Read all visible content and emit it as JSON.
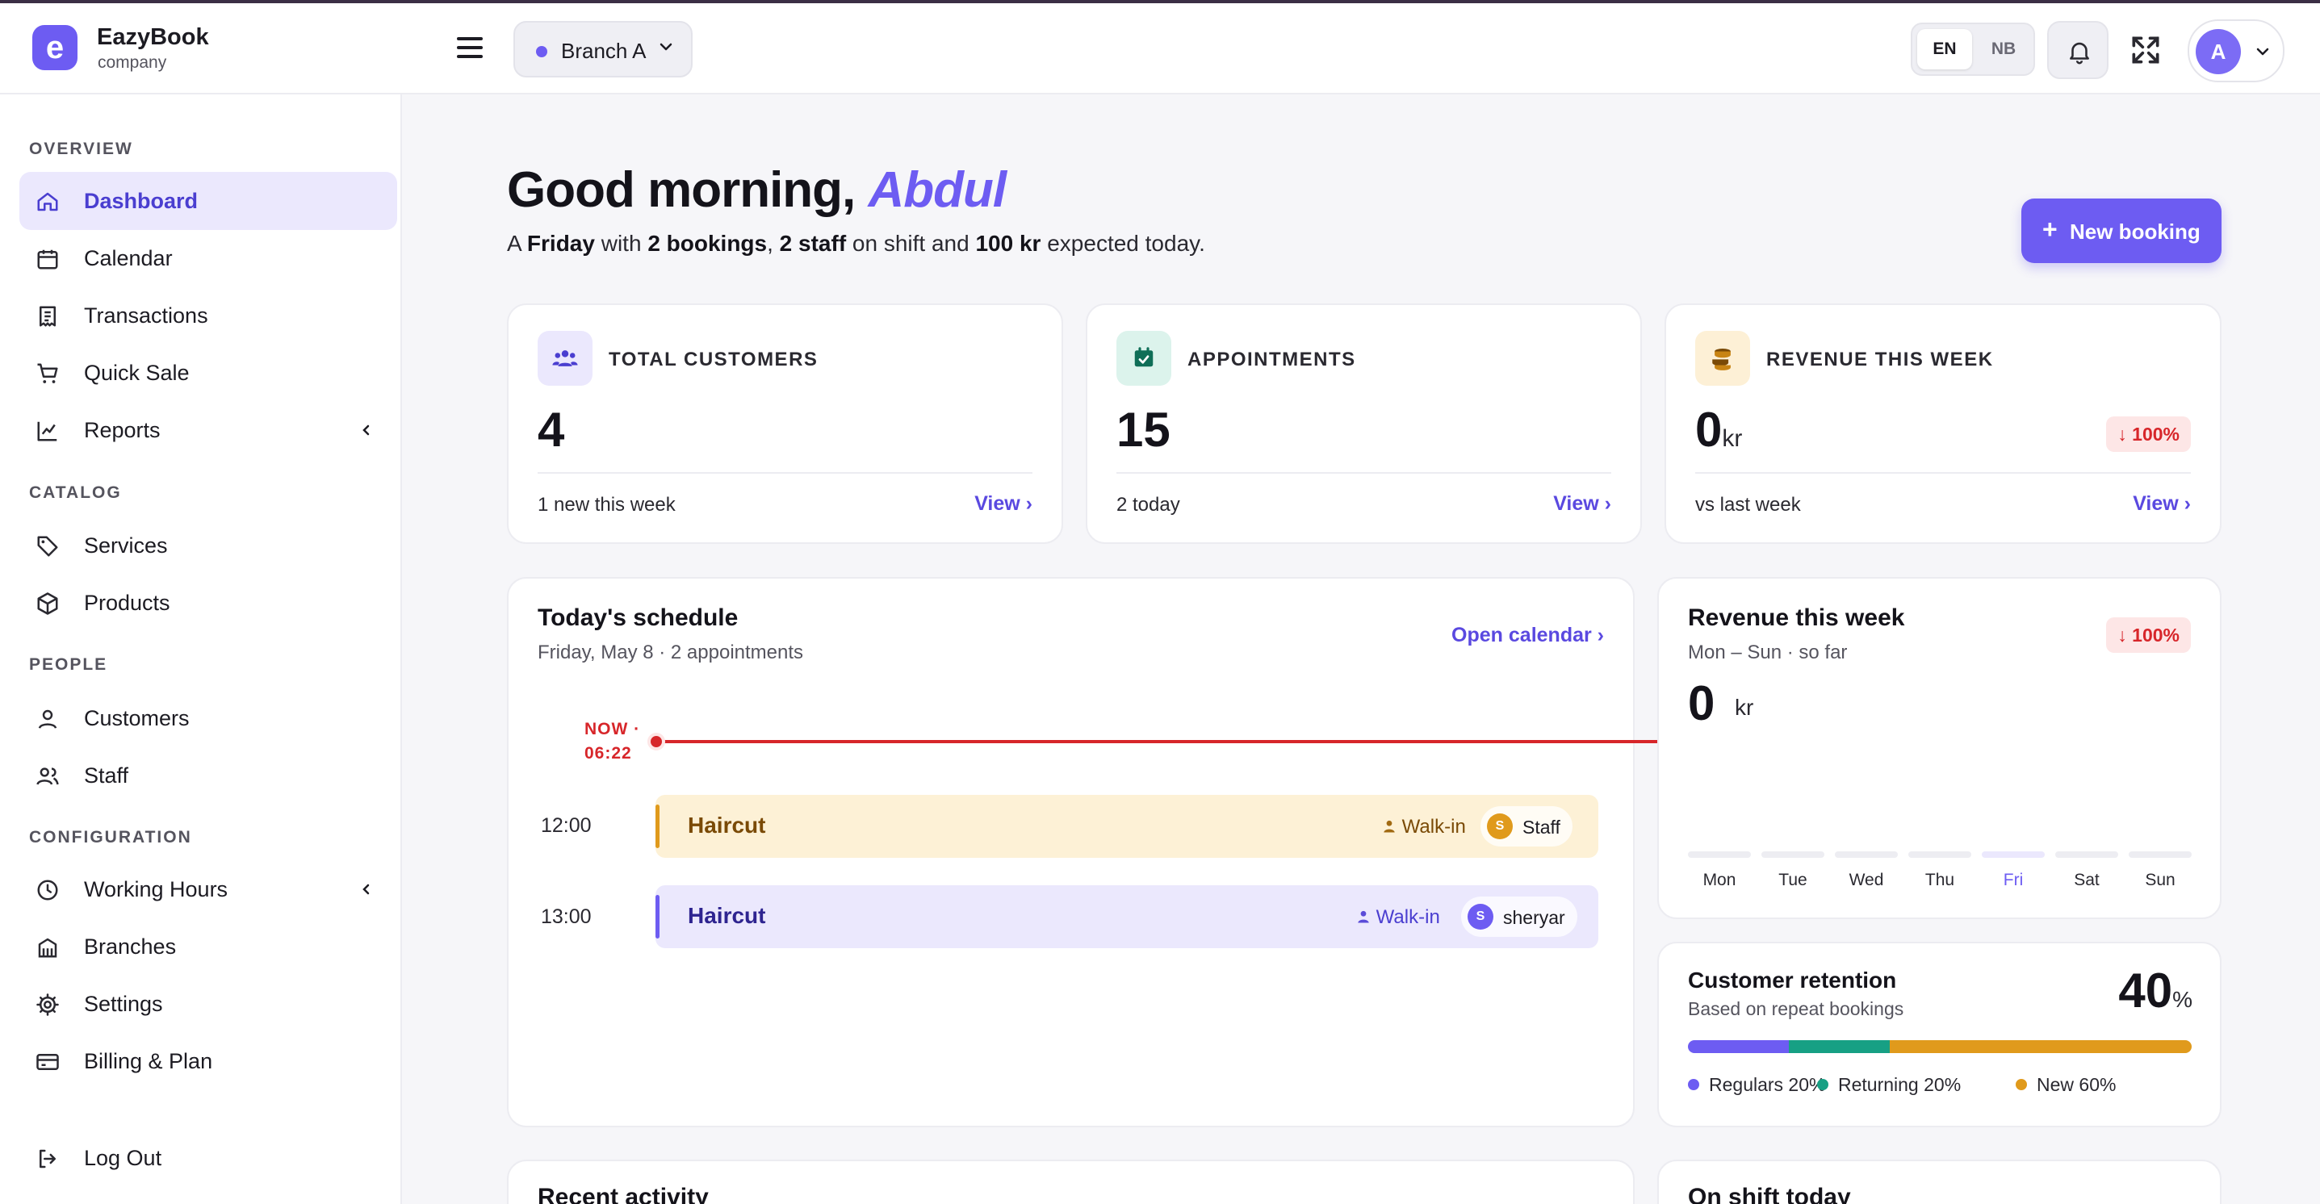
{
  "header": {
    "brand_name": "EazyBook",
    "brand_sub": "company",
    "logo_letter": "e",
    "branch_label": "Branch A",
    "lang_en": "EN",
    "lang_nb": "NB",
    "avatar_letter": "A"
  },
  "sidebar": {
    "sections": {
      "overview": "OVERVIEW",
      "catalog": "CATALOG",
      "people": "PEOPLE",
      "configuration": "CONFIGURATION"
    },
    "items": {
      "dashboard": "Dashboard",
      "calendar": "Calendar",
      "transactions": "Transactions",
      "quick_sale": "Quick Sale",
      "reports": "Reports",
      "services": "Services",
      "products": "Products",
      "customers": "Customers",
      "staff": "Staff",
      "working_hours": "Working Hours",
      "branches": "Branches",
      "settings": "Settings",
      "billing": "Billing & Plan",
      "logout": "Log Out"
    },
    "active_item": "dashboard"
  },
  "greeting": {
    "prefix": "Good morning, ",
    "name": "Abdul",
    "sub": {
      "p1": "A ",
      "day": "Friday",
      "p2": " with ",
      "bookings": "2 bookings",
      "p3": ", ",
      "staff": "2 staff",
      "p4": " on shift and ",
      "amount": "100 kr",
      "p5": " expected today."
    },
    "new_booking": "New booking"
  },
  "stats": {
    "customers": {
      "title": "TOTAL CUSTOMERS",
      "value": "4",
      "foot": "1 new this week",
      "view": "View"
    },
    "appointments": {
      "title": "APPOINTMENTS",
      "value": "15",
      "foot": "2 today",
      "view": "View"
    },
    "revenue": {
      "title": "REVENUE THIS WEEK",
      "value": "0",
      "unit": "kr",
      "badge": "100%",
      "foot": "vs last week",
      "view": "View"
    }
  },
  "schedule": {
    "title": "Today's schedule",
    "sub": "Friday, May 8 · 2 appointments",
    "open_calendar": "Open calendar",
    "now_line1": "NOW ·",
    "now_line2": "06:22",
    "appointments": [
      {
        "time": "12:00",
        "service": "Haircut",
        "type": "Walk-in",
        "staff_initial": "S",
        "staff": "Staff"
      },
      {
        "time": "13:00",
        "service": "Haircut",
        "type": "Walk-in",
        "staff_initial": "S",
        "staff": "sheryar"
      }
    ]
  },
  "revenue_week": {
    "title": "Revenue this week",
    "sub": "Mon – Sun · so far",
    "value": "0",
    "unit": "kr",
    "badge": "100%",
    "days": [
      "Mon",
      "Tue",
      "Wed",
      "Thu",
      "Fri",
      "Sat",
      "Sun"
    ],
    "values": [
      0,
      0,
      0,
      0,
      0,
      0,
      0
    ],
    "current_day": "Fri"
  },
  "retention": {
    "title": "Customer retention",
    "sub": "Based on repeat bookings",
    "value": "40",
    "unit": "%",
    "segments": [
      {
        "label": "Regulars 20%",
        "value": 20,
        "color": "#6d5cf2"
      },
      {
        "label": "Returning 20%",
        "value": 20,
        "color": "#17a084"
      },
      {
        "label": "New 60%",
        "value": 60,
        "color": "#e09a1c"
      }
    ]
  },
  "bottom": {
    "recent_activity": "Recent activity",
    "on_shift": "On shift today"
  },
  "colors": {
    "accent": "#6d5cf2",
    "danger": "#d7262a",
    "amber": "#e09a1c",
    "teal": "#17a084"
  }
}
